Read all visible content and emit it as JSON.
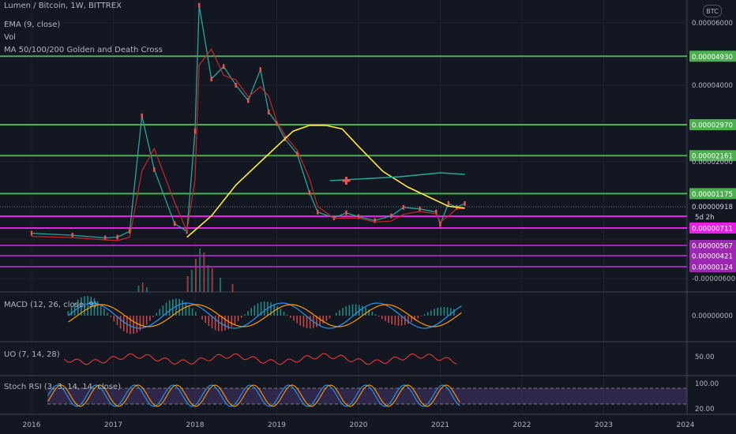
{
  "header": {
    "symbol_line": "Lumen / Bitcoin, 1W, BITTREX",
    "indicators": [
      "EMA (9, close)",
      "Vol",
      "MA 50/100/200 Golden and Death Cross"
    ],
    "currency": "BTC"
  },
  "panes": {
    "macd": "MACD (12, 26, close, 9)",
    "uo": "UO (7, 14, 28)",
    "stoch": "Stoch RSI (3, 3, 14, 14, close)"
  },
  "chart_data": {
    "type": "line",
    "price_axis_ticks": [
      "0.00006000",
      "0.00004000",
      "0.00002000",
      "-0.00000600"
    ],
    "macd_axis_tick": "0.00000000",
    "uo_axis_tick": "50.00",
    "stoch_axis_ticks": [
      "100.00",
      "20.00"
    ],
    "x_ticks": [
      "2016",
      "2017",
      "2018",
      "2019",
      "2020",
      "2021",
      "2022",
      "2023",
      "2024"
    ],
    "horizontal_levels": [
      {
        "label": "0.00004930",
        "value": 4.93e-05,
        "color": "#4caf50"
      },
      {
        "label": "0.00002970",
        "value": 2.97e-05,
        "color": "#4caf50"
      },
      {
        "label": "0.00002161",
        "value": 2.161e-05,
        "color": "#4caf50"
      },
      {
        "label": "0.00001175",
        "value": 1.175e-05,
        "color": "#4caf50"
      },
      {
        "label": "0.00000711",
        "value": 7.11e-06,
        "color": "#e91ee9"
      },
      {
        "label": "0.00000567",
        "value": 5.67e-06,
        "color": "#9c27b0"
      },
      {
        "label": "0.00000421",
        "value": 4.21e-06,
        "color": "#9c27b0"
      },
      {
        "label": "0.00000124",
        "value": 1.24e-06,
        "color": "#9c27b0"
      }
    ],
    "last_price": {
      "label": "0.00000918",
      "countdown": "5d 2h"
    },
    "price_series": {
      "x": [
        2016.0,
        2016.5,
        2016.9,
        2017.05,
        2017.2,
        2017.35,
        2017.5,
        2017.75,
        2017.9,
        2018.0,
        2018.05,
        2018.2,
        2018.35,
        2018.5,
        2018.65,
        2018.8,
        2018.9,
        2019.0,
        2019.1,
        2019.25,
        2019.4,
        2019.5,
        2019.7,
        2019.85,
        2020.0,
        2020.2,
        2020.4,
        2020.55,
        2020.75,
        2020.95,
        2021.0,
        2021.1,
        2021.2,
        2021.3
      ],
      "values": [
        1.5e-06,
        1e-06,
        3e-07,
        5e-07,
        2e-06,
        3.2e-05,
        1.8e-05,
        4e-06,
        2e-06,
        2.8e-05,
        6.5e-05,
        4.2e-05,
        4.6e-05,
        4e-05,
        3.6e-05,
        4.5e-05,
        3.3e-05,
        3e-05,
        2.6e-05,
        2.2e-05,
        1.2e-05,
        7e-06,
        5.5e-06,
        6.8e-06,
        5.8e-06,
        4.8e-06,
        6e-06,
        8.2e-06,
        7.8e-06,
        7e-06,
        3.8e-06,
        9.2e-06,
        8.2e-06,
        9.2e-06
      ]
    },
    "ma_200": {
      "x": [
        2017.9,
        2018.2,
        2018.5,
        2018.8,
        2019.0,
        2019.2,
        2019.4,
        2019.6,
        2019.8,
        2020.0,
        2020.3,
        2020.6,
        2020.9,
        2021.1,
        2021.3
      ],
      "values": [
        5e-07,
        6e-06,
        1.4e-05,
        2e-05,
        2.4e-05,
        2.8e-05,
        2.95e-05,
        2.95e-05,
        2.86e-05,
        2.4e-05,
        1.75e-05,
        1.35e-05,
        1.05e-05,
        8.5e-06,
        8e-06
      ]
    }
  }
}
